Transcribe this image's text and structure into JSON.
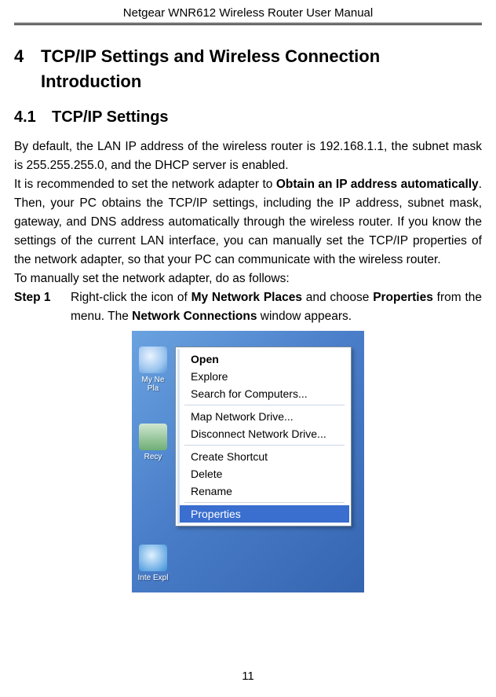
{
  "doc_header": "Netgear WNR612 Wireless Router User Manual",
  "section": {
    "number": "4",
    "title": "TCP/IP Settings and Wireless Connection Introduction"
  },
  "subsection": {
    "number": "4.1",
    "title": "TCP/IP Settings"
  },
  "body": {
    "p1a": "By default, the LAN IP address of the wireless router is 192.168.1.1, the subnet mask is 255.255.255.0, and the DHCP server is enabled.",
    "p2_pre": "It is recommended to set the network adapter to ",
    "p2_bold1": "Obtain an IP address automatically",
    "p2_post": ". Then, your PC obtains the TCP/IP settings, including the IP address, subnet mask, gateway, and DNS address automatically through the wireless router. If you know the settings of the current LAN interface, you can manually set the TCP/IP properties of the network adapter, so that your PC can communicate with the wireless router.",
    "p3": "To manually set the network adapter, do as follows:"
  },
  "step1": {
    "label": "Step 1",
    "t1": "Right-click the icon of ",
    "b1": "My Network Places",
    "t2": " and choose ",
    "b2": "Properties",
    "t3": " from the menu. The ",
    "b3": "Network Connections",
    "t4": " window appears."
  },
  "desktop": {
    "my_network": "My Ne\nPla",
    "recycle": "Recy",
    "ie": "Inte\nExpl"
  },
  "menu": {
    "open": "Open",
    "explore": "Explore",
    "search": "Search for Computers...",
    "map": "Map Network Drive...",
    "disconnect": "Disconnect Network Drive...",
    "shortcut": "Create Shortcut",
    "delete": "Delete",
    "rename": "Rename",
    "properties": "Properties"
  },
  "page_number": "11"
}
